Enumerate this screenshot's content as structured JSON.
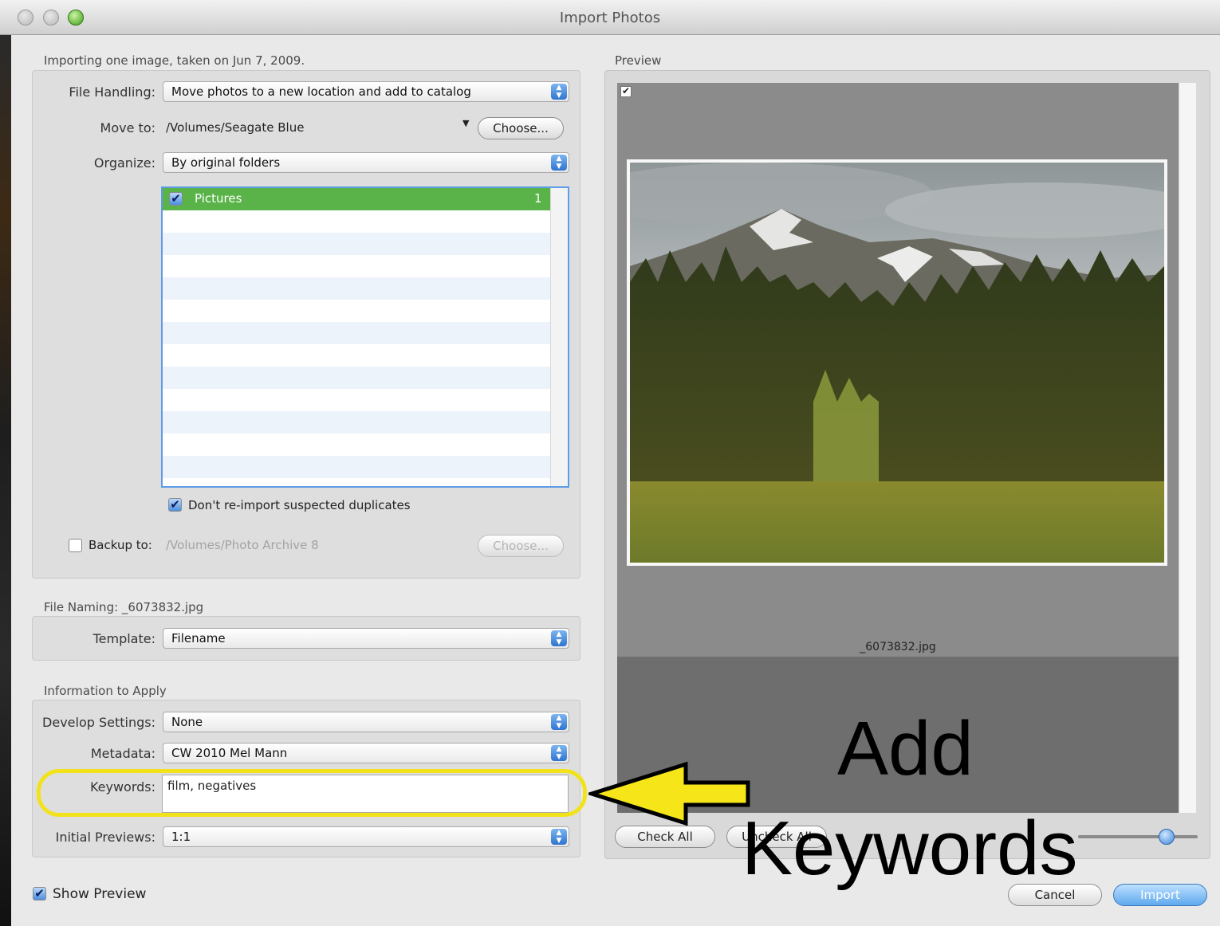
{
  "window": {
    "title": "Import Photos"
  },
  "summary": "Importing one image, taken on Jun 7, 2009.",
  "file_handling": {
    "label": "File Handling:",
    "value": "Move photos to a new location and add to catalog"
  },
  "move_to": {
    "label": "Move to:",
    "path": "/Volumes/Seagate Blue",
    "choose_label": "Choose..."
  },
  "organize": {
    "label": "Organize:",
    "value": "By original folders"
  },
  "folders": [
    {
      "name": "Pictures",
      "count": "1",
      "checked": true
    }
  ],
  "dont_reimport": {
    "label": "Don't re-import suspected duplicates",
    "checked": true
  },
  "backup": {
    "label": "Backup to:",
    "path": "/Volumes/Photo Archive 8",
    "choose_label": "Choose...",
    "checked": false
  },
  "file_naming": {
    "header": "File Naming:  _6073832.jpg",
    "template_label": "Template:",
    "template_value": "Filename"
  },
  "info": {
    "header": "Information to Apply",
    "develop_label": "Develop Settings:",
    "develop_value": "None",
    "metadata_label": "Metadata:",
    "metadata_value": "CW 2010 Mel Mann",
    "keywords_label": "Keywords:",
    "keywords_value": "film, negatives",
    "previews_label": "Initial Previews:",
    "previews_value": "1:1"
  },
  "preview": {
    "header": "Preview",
    "filename": "_6073832.jpg",
    "check_all": "Check All",
    "uncheck_all": "Uncheck All",
    "zoom_level": 0.75
  },
  "show_preview": {
    "label": "Show Preview",
    "checked": true
  },
  "buttons": {
    "cancel": "Cancel",
    "import": "Import"
  },
  "annotation": {
    "line1": "Add",
    "line2": "Keywords",
    "highlight_color": "#f2e21b",
    "arrow_color": "#f6e619"
  },
  "colors": {
    "folder_selected": "#5ab348",
    "accent_blue": "#4c8fde"
  }
}
